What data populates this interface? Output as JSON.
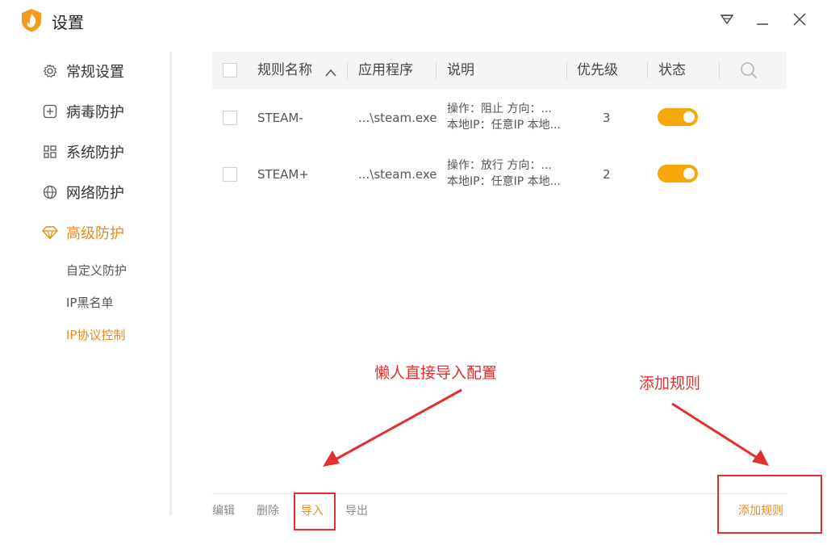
{
  "window": {
    "title": "设置",
    "controls": [
      "dropdown-icon",
      "minimize-icon",
      "close-icon"
    ]
  },
  "sidebar": {
    "items": [
      {
        "label": "常规设置",
        "icon": "gear-icon"
      },
      {
        "label": "病毒防护",
        "icon": "plus-box-icon"
      },
      {
        "label": "系统防护",
        "icon": "grid-icon"
      },
      {
        "label": "网络防护",
        "icon": "globe-icon"
      },
      {
        "label": "高级防护",
        "icon": "diamond-icon",
        "active": true
      }
    ],
    "sub_items": [
      {
        "label": "自定义防护"
      },
      {
        "label": "IP黑名单"
      },
      {
        "label": "IP协议控制",
        "active": true
      }
    ]
  },
  "table": {
    "headers": {
      "name": "规则名称",
      "app": "应用程序",
      "desc": "说明",
      "priority": "优先级",
      "status": "状态"
    },
    "rows": [
      {
        "name": "STEAM-",
        "app": "...\\steam.exe",
        "desc_line1": "操作：阻止 方向：...",
        "desc_line2": "本地IP：任意IP 本地...",
        "priority": "3",
        "enabled": true
      },
      {
        "name": "STEAM+",
        "app": "...\\steam.exe",
        "desc_line1": "操作：放行 方向：...",
        "desc_line2": "本地IP：任意IP 本地...",
        "priority": "2",
        "enabled": true
      }
    ]
  },
  "footer": {
    "edit": "编辑",
    "delete": "删除",
    "import": "导入",
    "export": "导出",
    "add_rule": "添加规则"
  },
  "annotations": {
    "import_note": "懒人直接导入配置",
    "add_note": "添加规则"
  },
  "colors": {
    "accent": "#e88a1a",
    "toggle_on": "#f6a70c",
    "annotation": "#e03030"
  }
}
